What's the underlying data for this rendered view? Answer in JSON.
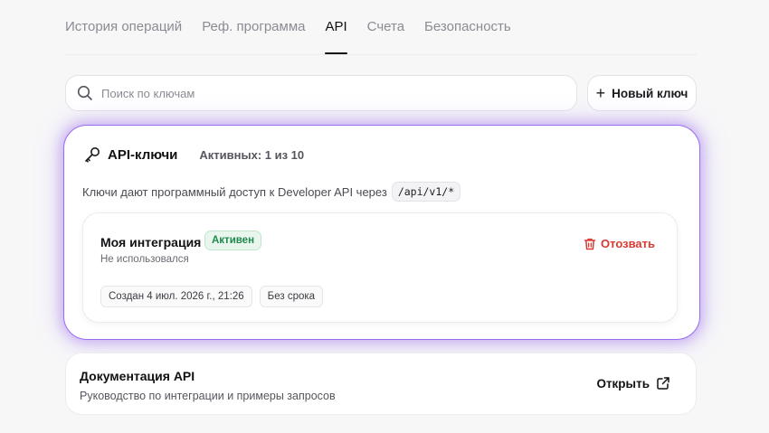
{
  "tabs": [
    {
      "label": "История операций",
      "active": false
    },
    {
      "label": "Реф. программа",
      "active": false
    },
    {
      "label": "API",
      "active": true
    },
    {
      "label": "Счета",
      "active": false
    },
    {
      "label": "Безопасность",
      "active": false
    }
  ],
  "search": {
    "placeholder": "Поиск по ключам",
    "value": "",
    "icon": "search-icon"
  },
  "new_key_button": {
    "label": "Новый ключ",
    "icon": "plus-icon"
  },
  "keys_card": {
    "title": "API-ключи",
    "icon": "key-icon",
    "active_count": "Активных: 1 из 10",
    "description": "Ключи дают программный доступ к Developer API через",
    "endpoint": "/api/v1/*",
    "accent_color": "#9b6cf0",
    "keys": [
      {
        "name": "Моя интеграция",
        "status": "Активен",
        "status_color": "#1f8a4c",
        "usage": "Не использовался",
        "created": "Создан 4 июл. 2026 г., 21:26",
        "expiry": "Без срока",
        "revoke_label": "Отозвать",
        "revoke_color": "#d93a32",
        "revoke_icon": "trash-icon"
      }
    ]
  },
  "docs_card": {
    "title": "Документация API",
    "subtitle": "Руководство по интеграции и примеры запросов",
    "open_label": "Открыть",
    "open_icon": "external-link-icon"
  }
}
